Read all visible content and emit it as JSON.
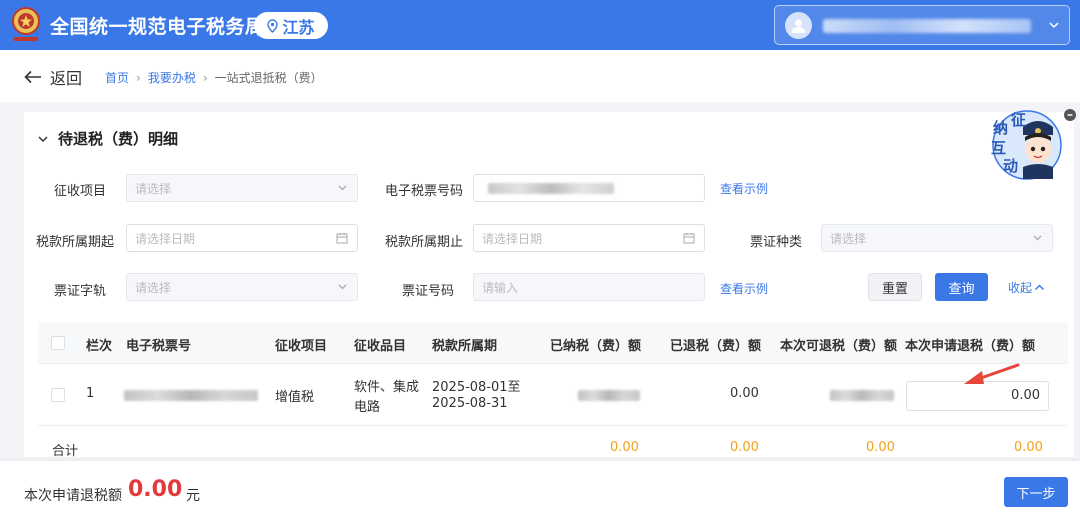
{
  "header": {
    "site_title": "全国统一规范电子税务局",
    "region": "江苏",
    "brand_color": "#3b78e7"
  },
  "subnav": {
    "back_label": "返回",
    "breadcrumb": [
      "首页",
      "我要办税",
      "一站式退抵税（费）"
    ]
  },
  "section": {
    "title": "待退税（费）明细"
  },
  "filters": {
    "tax_item_label": "征收项目",
    "tax_item_placeholder": "请选择",
    "e_ticket_label": "电子税票号码",
    "view_example_1": "查看示例",
    "period_start_label": "税款所属期起",
    "period_start_placeholder": "请选择日期",
    "period_end_label": "税款所属期止",
    "period_end_placeholder": "请选择日期",
    "voucher_type_label": "票证种类",
    "voucher_type_placeholder": "请选择",
    "voucher_track_label": "票证字轨",
    "voucher_track_placeholder": "请选择",
    "voucher_no_label": "票证号码",
    "voucher_no_placeholder": "请输入",
    "view_example_2": "查看示例",
    "reset_label": "重置",
    "query_label": "查询",
    "collapse_label": "收起"
  },
  "table": {
    "columns": [
      "栏次",
      "电子税票号",
      "征收项目",
      "征收品目",
      "税款所属期",
      "已纳税（费）额",
      "已退税（费）额",
      "本次可退税（费）额",
      "本次申请退税（费）额"
    ],
    "rows": [
      {
        "index": "1",
        "tax_item": "增值税",
        "category_line1": "软件、集成",
        "category_line2": "电路",
        "period_line1": "2025-08-01至",
        "period_line2": "2025-08-31",
        "refunded": "0.00",
        "apply_amount": "0.00"
      }
    ],
    "total_label": "合计",
    "totals": [
      "0.00",
      "0.00",
      "0.00",
      "0.00"
    ]
  },
  "assistant": {
    "text": [
      "征",
      "纳",
      "互",
      "动"
    ]
  },
  "footer": {
    "label": "本次申请退税额",
    "amount": "0.00",
    "unit": "元",
    "next_label": "下一步"
  }
}
